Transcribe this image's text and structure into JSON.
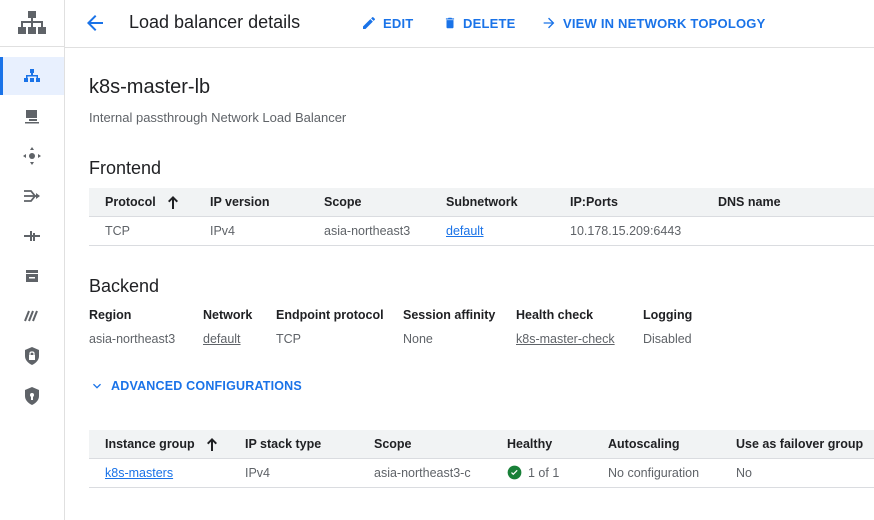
{
  "rail": {
    "logo_icon": "network-hierarchy-icon",
    "items": [
      {
        "icon": "load-balancing-icon",
        "active": true
      },
      {
        "icon": "cloud-interconnect-icon"
      },
      {
        "icon": "network-connectivity-icon"
      },
      {
        "icon": "routes-icon"
      },
      {
        "icon": "vpn-icon"
      },
      {
        "icon": "storage-icon"
      },
      {
        "icon": "network-intelligence-icon"
      },
      {
        "icon": "lock-shield-icon"
      },
      {
        "icon": "security-shield-icon"
      }
    ]
  },
  "header": {
    "title": "Load balancer details",
    "edit_label": "EDIT",
    "delete_label": "DELETE",
    "topology_label": "VIEW IN NETWORK TOPOLOGY"
  },
  "lb": {
    "name": "k8s-master-lb",
    "type": "Internal passthrough Network Load Balancer"
  },
  "frontend": {
    "heading": "Frontend",
    "columns": [
      "Protocol",
      "IP version",
      "Scope",
      "Subnetwork",
      "IP:Ports",
      "DNS name"
    ],
    "rows": [
      {
        "protocol": "TCP",
        "ip_version": "IPv4",
        "scope": "asia-northeast3",
        "subnetwork": "default",
        "ip_ports": "10.178.15.209:6443",
        "dns_name": ""
      }
    ]
  },
  "backend": {
    "heading": "Backend",
    "labels": {
      "region": "Region",
      "network": "Network",
      "endpoint_protocol": "Endpoint protocol",
      "session_affinity": "Session affinity",
      "health_check": "Health check",
      "logging": "Logging"
    },
    "values": {
      "region": "asia-northeast3",
      "network": "default",
      "endpoint_protocol": "TCP",
      "session_affinity": "None",
      "health_check": "k8s-master-check",
      "logging": "Disabled"
    },
    "advanced_label": "ADVANCED CONFIGURATIONS",
    "columns": [
      "Instance group",
      "IP stack type",
      "Scope",
      "Healthy",
      "Autoscaling",
      "Use as failover group"
    ],
    "rows": [
      {
        "instance_group": "k8s-masters",
        "ip_stack_type": "IPv4",
        "scope": "asia-northeast3-c",
        "healthy": "1 of 1",
        "autoscaling": "No configuration",
        "failover": "No"
      }
    ]
  },
  "colors": {
    "accent": "#1a73e8",
    "healthy": "#188038",
    "rail_active_bg": "#e8f0fe"
  }
}
